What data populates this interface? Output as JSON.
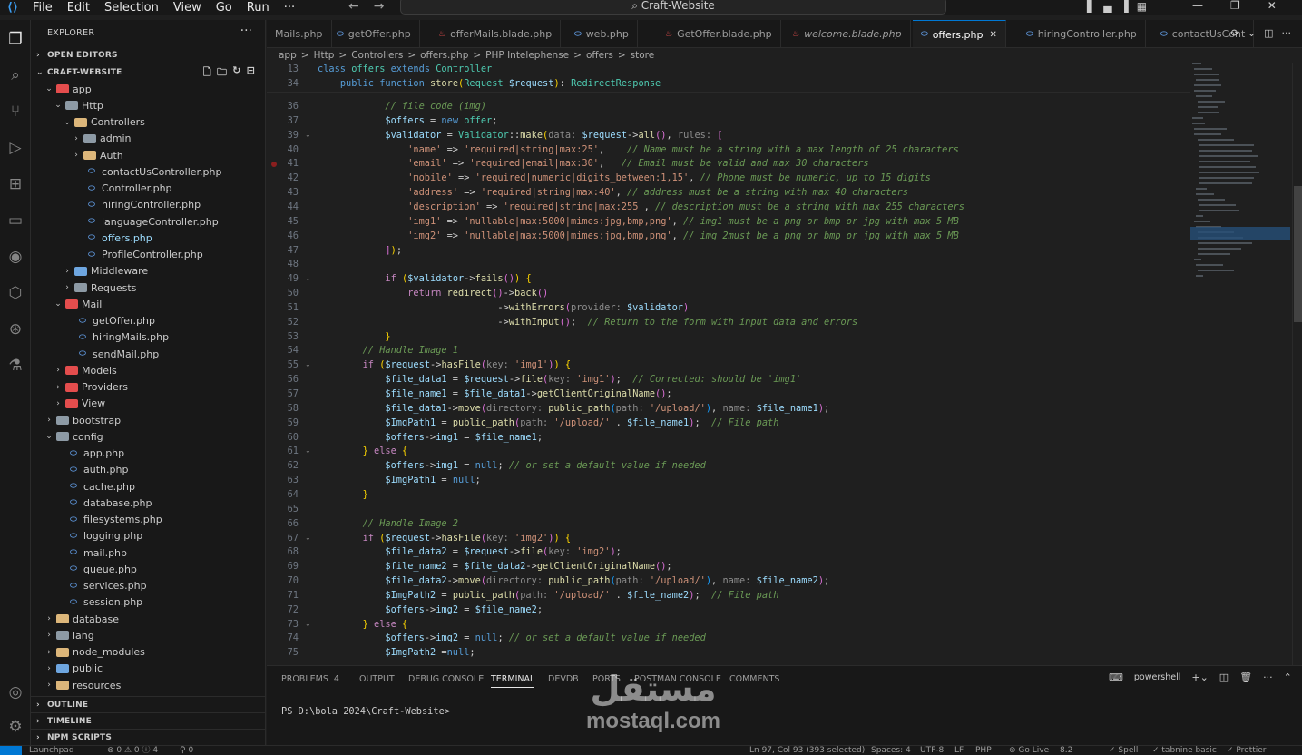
{
  "titlebar": {
    "menus": [
      "File",
      "Edit",
      "Selection",
      "View",
      "Go",
      "Run",
      "···"
    ],
    "command_center": "Craft-Website"
  },
  "explorer": {
    "header": "EXPLORER",
    "open_editors": "OPEN EDITORS",
    "project": "CRAFT-WEBSITE",
    "outline": "OUTLINE",
    "timeline": "TIMELINE",
    "npm_scripts": "NPM SCRIPTS",
    "tree": [
      {
        "label": "app",
        "depth": 1,
        "kind": "fred",
        "open": true
      },
      {
        "label": "Http",
        "depth": 2,
        "kind": "fgray",
        "open": true
      },
      {
        "label": "Controllers",
        "depth": 3,
        "kind": "folder",
        "open": true
      },
      {
        "label": "admin",
        "depth": 4,
        "kind": "fgray",
        "open": false
      },
      {
        "label": "Auth",
        "depth": 4,
        "kind": "folder",
        "open": false
      },
      {
        "label": "contactUsController.php",
        "depth": 4,
        "kind": "php"
      },
      {
        "label": "Controller.php",
        "depth": 4,
        "kind": "php"
      },
      {
        "label": "hiringController.php",
        "depth": 4,
        "kind": "php"
      },
      {
        "label": "languageController.php",
        "depth": 4,
        "kind": "php"
      },
      {
        "label": "offers.php",
        "depth": 4,
        "kind": "php",
        "selected": true
      },
      {
        "label": "ProfileController.php",
        "depth": 4,
        "kind": "php"
      },
      {
        "label": "Middleware",
        "depth": 3,
        "kind": "fblue",
        "open": false
      },
      {
        "label": "Requests",
        "depth": 3,
        "kind": "fgray",
        "open": false
      },
      {
        "label": "Mail",
        "depth": 2,
        "kind": "fred",
        "open": true
      },
      {
        "label": "getOffer.php",
        "depth": 3,
        "kind": "php"
      },
      {
        "label": "hiringMails.php",
        "depth": 3,
        "kind": "php"
      },
      {
        "label": "sendMail.php",
        "depth": 3,
        "kind": "php"
      },
      {
        "label": "Models",
        "depth": 2,
        "kind": "fred",
        "open": false
      },
      {
        "label": "Providers",
        "depth": 2,
        "kind": "fred",
        "open": false
      },
      {
        "label": "View",
        "depth": 2,
        "kind": "fred",
        "open": false
      },
      {
        "label": "bootstrap",
        "depth": 1,
        "kind": "fgray",
        "open": false
      },
      {
        "label": "config",
        "depth": 1,
        "kind": "fgray",
        "open": true
      },
      {
        "label": "app.php",
        "depth": 2,
        "kind": "php"
      },
      {
        "label": "auth.php",
        "depth": 2,
        "kind": "php"
      },
      {
        "label": "cache.php",
        "depth": 2,
        "kind": "php"
      },
      {
        "label": "database.php",
        "depth": 2,
        "kind": "php"
      },
      {
        "label": "filesystems.php",
        "depth": 2,
        "kind": "php"
      },
      {
        "label": "logging.php",
        "depth": 2,
        "kind": "php"
      },
      {
        "label": "mail.php",
        "depth": 2,
        "kind": "php"
      },
      {
        "label": "queue.php",
        "depth": 2,
        "kind": "php"
      },
      {
        "label": "services.php",
        "depth": 2,
        "kind": "php"
      },
      {
        "label": "session.php",
        "depth": 2,
        "kind": "php"
      },
      {
        "label": "database",
        "depth": 1,
        "kind": "folder",
        "open": false
      },
      {
        "label": "lang",
        "depth": 1,
        "kind": "fgray",
        "open": false
      },
      {
        "label": "node_modules",
        "depth": 1,
        "kind": "folder",
        "open": false
      },
      {
        "label": "public",
        "depth": 1,
        "kind": "fblue",
        "open": false
      },
      {
        "label": "resources",
        "depth": 1,
        "kind": "folder",
        "open": false
      }
    ]
  },
  "tabs": [
    {
      "label": "Mails.php",
      "kind": "php"
    },
    {
      "label": "getOffer.php",
      "kind": "php"
    },
    {
      "label": "offerMails.blade.php",
      "kind": "blade"
    },
    {
      "label": "web.php",
      "kind": "php"
    },
    {
      "label": "GetOffer.blade.php",
      "kind": "blade"
    },
    {
      "label": "welcome.blade.php",
      "kind": "blade"
    },
    {
      "label": "offers.php",
      "kind": "php",
      "active": true
    },
    {
      "label": "hiringController.php",
      "kind": "php"
    },
    {
      "label": "contactUsCont",
      "kind": "php"
    }
  ],
  "breadcrumb": [
    "app",
    ">",
    "Http",
    ">",
    "Controllers",
    ">",
    "offers.php",
    ">",
    "PHP Intelephense",
    ">",
    "offers",
    ">",
    "store"
  ],
  "editor": {
    "sticky": [
      {
        "n": "13",
        "html": "<span class='c-kw2'>class</span> <span class='c-cls'>offers</span> <span class='c-kw2'>extends</span> <span class='c-cls'>Controller</span>"
      },
      {
        "n": "34",
        "html": "    <span class='c-kw2'>public</span> <span class='c-kw2'>function</span> <span class='c-fn'>store</span><span class='c-br'>(</span><span class='c-cls'>Request</span> <span class='c-var'>$request</span><span class='c-br'>)</span>: <span class='c-cls'>RedirectResponse</span>"
      }
    ],
    "lines": [
      {
        "n": "36",
        "html": "            <span class='c-cm'>// file code (img)</span>"
      },
      {
        "n": "37",
        "html": "            <span class='c-var'>$offers</span> = <span class='c-kw2'>new</span> <span class='c-cls'>offer</span>;"
      },
      {
        "n": "39",
        "fold": true,
        "html": "            <span class='c-var'>$validator</span> = <span class='c-cls'>Validator</span>::<span class='c-fn'>make</span><span class='c-br'>(</span><span class='c-hint'>data: </span><span class='c-var'>$request</span>-&gt;<span class='c-fn'>all</span><span class='c-br2'>()</span>, <span class='c-hint'>rules: </span><span class='c-br2'>[</span>"
      },
      {
        "n": "40",
        "html": "                <span class='c-str'>'name'</span> =&gt; <span class='c-str'>'required|string|max:25'</span>,    <span class='c-cm'>// Name must be a string with a max length of 25 characters</span>"
      },
      {
        "n": "41",
        "bp": true,
        "html": "                <span class='c-str'>'email'</span> =&gt; <span class='c-str'>'required|email|max:30'</span>,   <span class='c-cm'>// Email must be valid and max 30 characters</span>"
      },
      {
        "n": "42",
        "html": "                <span class='c-str'>'mobile'</span> =&gt; <span class='c-str'>'required|numeric|digits_between:1,15'</span>, <span class='c-cm'>// Phone must be numeric, up to 15 digits</span>"
      },
      {
        "n": "43",
        "html": "                <span class='c-str'>'address'</span> =&gt; <span class='c-str'>'required|string|max:40'</span>, <span class='c-cm'>// address must be a string with max 40 characters</span>"
      },
      {
        "n": "44",
        "html": "                <span class='c-str'>'description'</span> =&gt; <span class='c-str'>'required|string|max:255'</span>, <span class='c-cm'>// description must be a string with max 255 characters</span>"
      },
      {
        "n": "45",
        "html": "                <span class='c-str'>'img1'</span> =&gt; <span class='c-str'>'nullable|max:5000|mimes:jpg,bmp,png'</span>, <span class='c-cm'>// img1 must be a png or bmp or jpg with max 5 MB</span>"
      },
      {
        "n": "46",
        "html": "                <span class='c-str'>'img2'</span> =&gt; <span class='c-str'>'nullable|max:5000|mimes:jpg,bmp,png'</span>, <span class='c-cm'>// img 2must be a png or bmp or jpg with max 5 MB</span>"
      },
      {
        "n": "47",
        "html": "            <span class='c-br2'>]</span><span class='c-br'>)</span>;"
      },
      {
        "n": "48",
        "html": ""
      },
      {
        "n": "49",
        "fold": true,
        "html": "            <span class='c-kw'>if</span> <span class='c-br'>(</span><span class='c-var'>$validator</span>-&gt;<span class='c-fn'>fails</span><span class='c-br2'>()</span><span class='c-br'>)</span> <span class='c-br'>{</span>"
      },
      {
        "n": "50",
        "html": "                <span class='c-kw'>return</span> <span class='c-fn'>redirect</span><span class='c-br2'>()</span>-&gt;<span class='c-fn'>back</span><span class='c-br2'>()</span>"
      },
      {
        "n": "51",
        "html": "                                -&gt;<span class='c-fn'>withErrors</span><span class='c-br2'>(</span><span class='c-hint'>provider: </span><span class='c-var'>$validator</span><span class='c-br2'>)</span>"
      },
      {
        "n": "52",
        "html": "                                -&gt;<span class='c-fn'>withInput</span><span class='c-br2'>()</span>;  <span class='c-cm'>// Return to the form with input data and errors</span>"
      },
      {
        "n": "53",
        "html": "            <span class='c-br'>}</span>"
      },
      {
        "n": "54",
        "html": "        <span class='c-cm'>// Handle Image 1</span>"
      },
      {
        "n": "55",
        "fold": true,
        "html": "        <span class='c-kw'>if</span> <span class='c-br'>(</span><span class='c-var'>$request</span>-&gt;<span class='c-fn'>hasFile</span><span class='c-br2'>(</span><span class='c-hint'>key: </span><span class='c-str'>'img1'</span><span class='c-br2'>)</span><span class='c-br'>)</span> <span class='c-br'>{</span>"
      },
      {
        "n": "56",
        "html": "            <span class='c-var'>$file_data1</span> = <span class='c-var'>$request</span>-&gt;<span class='c-fn'>file</span><span class='c-br2'>(</span><span class='c-hint'>key: </span><span class='c-str'>'img1'</span><span class='c-br2'>)</span>;  <span class='c-cm'>// Corrected: should be 'img1'</span>"
      },
      {
        "n": "57",
        "html": "            <span class='c-var'>$file_name1</span> = <span class='c-var'>$file_data1</span>-&gt;<span class='c-fn'>getClientOriginalName</span><span class='c-br2'>()</span>;"
      },
      {
        "n": "58",
        "html": "            <span class='c-var'>$file_data1</span>-&gt;<span class='c-fn'>move</span><span class='c-br2'>(</span><span class='c-hint'>directory: </span><span class='c-fn'>public_path</span><span class='c-br3'>(</span><span class='c-hint'>path: </span><span class='c-str'>'/upload/'</span><span class='c-br3'>)</span>, <span class='c-hint'>name: </span><span class='c-var'>$file_name1</span><span class='c-br2'>)</span>;"
      },
      {
        "n": "59",
        "html": "            <span class='c-var'>$ImgPath1</span> = <span class='c-fn'>public_path</span><span class='c-br2'>(</span><span class='c-hint'>path: </span><span class='c-str'>'/upload/'</span> . <span class='c-var'>$file_name1</span><span class='c-br2'>)</span>;  <span class='c-cm'>// File path</span>"
      },
      {
        "n": "60",
        "html": "            <span class='c-var'>$offers</span>-&gt;<span class='c-var'>img1</span> = <span class='c-var'>$file_name1</span>;"
      },
      {
        "n": "61",
        "fold": true,
        "html": "        <span class='c-br'>}</span> <span class='c-kw'>else</span> <span class='c-br'>{</span>"
      },
      {
        "n": "62",
        "html": "            <span class='c-var'>$offers</span>-&gt;<span class='c-var'>img1</span> = <span class='c-kw2'>null</span>; <span class='c-cm'>// or set a default value if needed</span>"
      },
      {
        "n": "63",
        "html": "            <span class='c-var'>$ImgPath1</span> = <span class='c-kw2'>null</span>;"
      },
      {
        "n": "64",
        "html": "        <span class='c-br'>}</span>"
      },
      {
        "n": "65",
        "html": ""
      },
      {
        "n": "66",
        "html": "        <span class='c-cm'>// Handle Image 2</span>"
      },
      {
        "n": "67",
        "fold": true,
        "html": "        <span class='c-kw'>if</span> <span class='c-br'>(</span><span class='c-var'>$request</span>-&gt;<span class='c-fn'>hasFile</span><span class='c-br2'>(</span><span class='c-hint'>key: </span><span class='c-str'>'img2'</span><span class='c-br2'>)</span><span class='c-br'>)</span> <span class='c-br'>{</span>"
      },
      {
        "n": "68",
        "html": "            <span class='c-var'>$file_data2</span> = <span class='c-var'>$request</span>-&gt;<span class='c-fn'>file</span><span class='c-br2'>(</span><span class='c-hint'>key: </span><span class='c-str'>'img2'</span><span class='c-br2'>)</span>;"
      },
      {
        "n": "69",
        "html": "            <span class='c-var'>$file_name2</span> = <span class='c-var'>$file_data2</span>-&gt;<span class='c-fn'>getClientOriginalName</span><span class='c-br2'>()</span>;"
      },
      {
        "n": "70",
        "html": "            <span class='c-var'>$file_data2</span>-&gt;<span class='c-fn'>move</span><span class='c-br2'>(</span><span class='c-hint'>directory: </span><span class='c-fn'>public_path</span><span class='c-br3'>(</span><span class='c-hint'>path: </span><span class='c-str'>'/upload/'</span><span class='c-br3'>)</span>, <span class='c-hint'>name: </span><span class='c-var'>$file_name2</span><span class='c-br2'>)</span>;"
      },
      {
        "n": "71",
        "html": "            <span class='c-var'>$ImgPath2</span> = <span class='c-fn'>public_path</span><span class='c-br2'>(</span><span class='c-hint'>path: </span><span class='c-str'>'/upload/'</span> . <span class='c-var'>$file_name2</span><span class='c-br2'>)</span>;  <span class='c-cm'>// File path</span>"
      },
      {
        "n": "72",
        "html": "            <span class='c-var'>$offers</span>-&gt;<span class='c-var'>img2</span> = <span class='c-var'>$file_name2</span>;"
      },
      {
        "n": "73",
        "fold": true,
        "html": "        <span class='c-br'>}</span> <span class='c-kw'>else</span> <span class='c-br'>{</span>"
      },
      {
        "n": "74",
        "html": "            <span class='c-var'>$offers</span>-&gt;<span class='c-var'>img2</span> = <span class='c-kw2'>null</span>; <span class='c-cm'>// or set a default value if needed</span>"
      },
      {
        "n": "75",
        "html": "            <span class='c-var'>$ImgPath2</span> =<span class='c-kw2'>null</span>;"
      }
    ]
  },
  "panel": {
    "tabs": [
      "PROBLEMS",
      "OUTPUT",
      "DEBUG CONSOLE",
      "TERMINAL",
      "DEVDB",
      "PORTS",
      "POSTMAN CONSOLE",
      "COMMENTS"
    ],
    "problems_count": "4",
    "active_tab": "TERMINAL",
    "shell": "powershell",
    "prompt": "PS D:\\bola 2024\\Craft-Website>"
  },
  "watermark": {
    "arabic": "مستقل",
    "latin": "mostaql.com"
  },
  "statusbar": {
    "launchpad": "Launchpad",
    "problems": "⊗ 0  ⚠ 0  ⓘ 4",
    "ports": "⚲ 0",
    "cursor": "Ln 97, Col 93 (393 selected)",
    "spaces": "Spaces: 4",
    "encoding": "UTF-8",
    "eol": "LF",
    "language": "PHP",
    "golive": "⊚ Go Live",
    "version": "8.2",
    "spell": "✓ Spell",
    "tabnine": "✓ tabnine basic",
    "prettier": "✓ Prettier"
  }
}
